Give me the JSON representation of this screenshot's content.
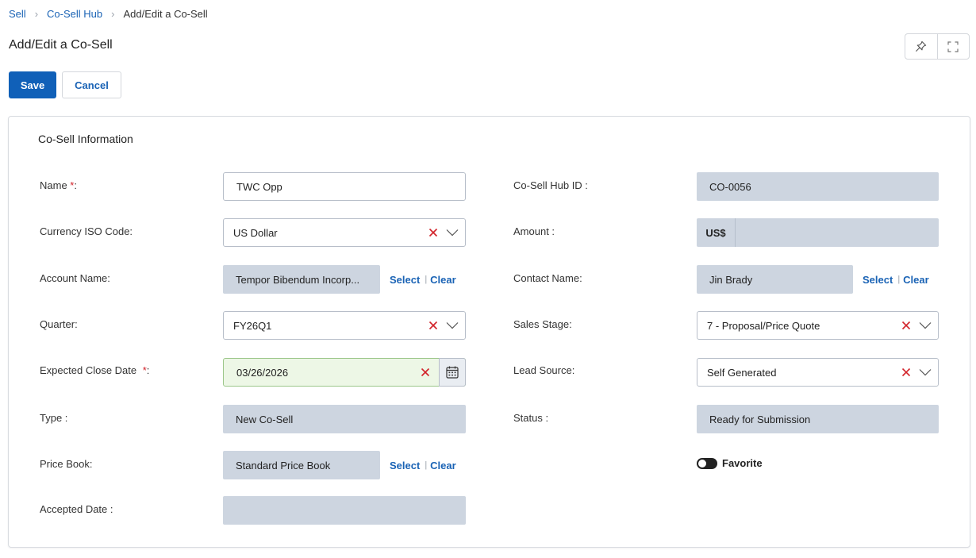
{
  "breadcrumb": {
    "items": [
      "Sell",
      "Co-Sell Hub"
    ],
    "current": "Add/Edit a Co-Sell"
  },
  "page": {
    "title": "Add/Edit a Co-Sell"
  },
  "toolbar": {
    "save_label": "Save",
    "cancel_label": "Cancel"
  },
  "section": {
    "title": "Co-Sell Information"
  },
  "fields": {
    "name": {
      "label": "Name ",
      "required": "*",
      "colon": ":",
      "value": "TWC Opp"
    },
    "currency": {
      "label": "Currency ISO Code:",
      "value": "US Dollar"
    },
    "account": {
      "label": "Account Name:",
      "value": "Tempor Bibendum Incorp...",
      "select": "Select",
      "clear": "Clear",
      "pipe": "|"
    },
    "quarter": {
      "label": "Quarter:",
      "value": "FY26Q1"
    },
    "close_date": {
      "label": "Expected Close Date ",
      "required": "*",
      "colon": ":",
      "value": "03/26/2026"
    },
    "type": {
      "label": "Type :",
      "value": "New Co-Sell"
    },
    "price_book": {
      "label": "Price Book:",
      "value": "Standard Price Book",
      "select": "Select",
      "clear": "Clear",
      "pipe": "|"
    },
    "accepted_date": {
      "label": "Accepted Date :",
      "value": ""
    },
    "hub_id": {
      "label": "Co-Sell Hub ID :",
      "value": "CO-0056"
    },
    "amount": {
      "label": "Amount :",
      "prefix": "US$",
      "value": ""
    },
    "contact": {
      "label": "Contact Name:",
      "value": "Jin Brady",
      "select": "Select",
      "clear": "Clear",
      "pipe": "|"
    },
    "sales_stage": {
      "label": "Sales Stage:",
      "value": "7 - Proposal/Price Quote"
    },
    "lead_source": {
      "label": "Lead Source:",
      "value": "Self Generated"
    },
    "status": {
      "label": "Status :",
      "value": "Ready for Submission"
    },
    "favorite": {
      "label": "Favorite",
      "on": false
    }
  },
  "icons": {
    "pin": "pin-icon",
    "expand": "expand-icon",
    "clear": "clear-x-icon",
    "dropdown": "chevron-down-icon",
    "calendar": "calendar-icon"
  },
  "colors": {
    "primary": "#1060b8",
    "link": "#1a63b5",
    "required": "#d2232a",
    "readonly_bg": "#cdd5e0",
    "date_bg": "#edf7e6"
  }
}
